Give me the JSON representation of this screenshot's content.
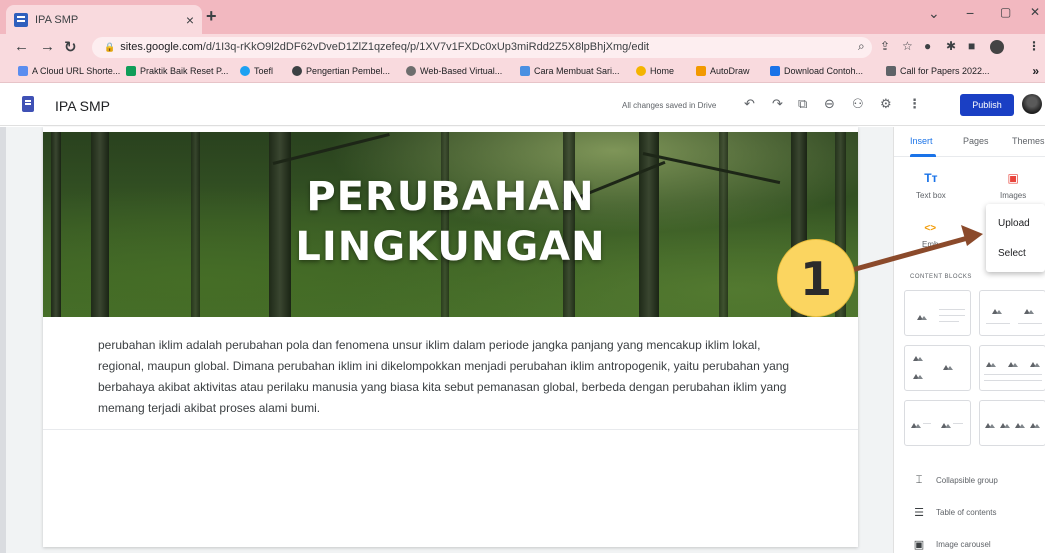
{
  "browser": {
    "tab_title": "IPA SMP",
    "tab_close": "×",
    "new_tab": "+",
    "window_controls": {
      "chevron": "⌄",
      "minimize": "−",
      "maximize": "▢",
      "close": "✕"
    },
    "nav": {
      "back": "←",
      "forward": "→",
      "reload": "↻"
    },
    "url_domain": "sites.google.com",
    "url_path": "/d/1I3q-rKkO9l2dDF62vDveD1ZlZ1qzefeq/p/1XV7v1FXDc0xUp3miRdd2Z5X8lpBhjXmg/edit",
    "bookmarks": [
      {
        "label": "A Cloud URL Shorte...",
        "color": "#5b8def"
      },
      {
        "label": "Praktik Baik Reset P...",
        "color": "#0f9d58"
      },
      {
        "label": "Toefl",
        "color": "#1da1f2"
      },
      {
        "label": "Pengertian Pembel...",
        "color": "#3c4043"
      },
      {
        "label": "Web-Based Virtual...",
        "color": "#6d6d6d"
      },
      {
        "label": "Cara Membuat Sari...",
        "color": "#4a90e2"
      },
      {
        "label": "Home",
        "color": "#f4b400"
      },
      {
        "label": "AutoDraw",
        "color": "#f29900"
      },
      {
        "label": "Download Contoh...",
        "color": "#1a73e8"
      },
      {
        "label": "Call for Papers 2022...",
        "color": "#5f6368"
      }
    ],
    "bookmarks_more": "»"
  },
  "editor": {
    "site_name": "IPA SMP",
    "save_status": "All changes saved in Drive",
    "publish_label": "Publish",
    "icons": [
      "undo-icon",
      "redo-icon",
      "preview-icon",
      "link-icon",
      "share-icon",
      "settings-icon",
      "more-icon"
    ]
  },
  "page": {
    "banner_title_line1": "PERUBAHAN",
    "banner_title_line2": "LINGKUNGAN",
    "body_text": "perubahan iklim adalah perubahan pola dan fenomena unsur iklim dalam periode jangka panjang yang mencakup iklim lokal, regional, maupun global. Dimana perubahan iklim ini dikelompokkan menjadi perubahan iklim antropogenik, yaitu perubahan yang berbahaya akibat aktivitas atau perilaku manusia yang biasa kita sebut pemanasan global, berbeda dengan perubahan iklim yang memang terjadi akibat proses alami bumi."
  },
  "panel": {
    "tabs": [
      "Insert",
      "Pages",
      "Themes"
    ],
    "active_tab": "Insert",
    "textbox_label": "Text box",
    "textbox_icon": "Tт",
    "images_label": "Images",
    "embed_label": "Emb",
    "embed_icon": "<>",
    "section_label": "CONTENT BLOCKS",
    "components": [
      {
        "label": "Collapsible group",
        "icon": "collapsible-group-icon",
        "glyph": "⌶"
      },
      {
        "label": "Table of contents",
        "icon": "table-of-contents-icon",
        "glyph": "☰"
      },
      {
        "label": "Image carousel",
        "icon": "image-carousel-icon",
        "glyph": "▣"
      }
    ]
  },
  "images_menu": {
    "items": [
      "Upload",
      "Select"
    ]
  },
  "annotation": {
    "number": "1",
    "color": "#fbd560",
    "arrow_color": "#8b4a2b"
  },
  "colors": {
    "chrome_frame": "#f2b8c0",
    "publish": "#1a3fc4",
    "accent": "#1a73e8"
  }
}
